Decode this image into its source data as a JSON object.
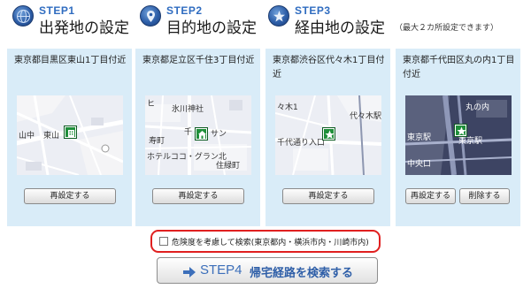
{
  "steps": [
    {
      "number": "STEP1",
      "title": "出発地の設定"
    },
    {
      "number": "STEP2",
      "title": "目的地の設定"
    },
    {
      "number": "STEP3",
      "title": "経由地の設定"
    }
  ],
  "step3_note": "（最大２カ所設定できます）",
  "panels": [
    {
      "address": "東京都目黒区東山1丁目付近",
      "map_labels": [
        "山中",
        "東山"
      ],
      "pin_icon": "building-pin-icon",
      "buttons": [
        "再設定する"
      ]
    },
    {
      "address": "東京都足立区千住3丁目付近",
      "map_labels": [
        "ヒ",
        "氷川神社",
        "寿町",
        "千",
        "サン",
        "ホテルココ・グラン北",
        "住緑町"
      ],
      "pin_icon": "house-pin-icon",
      "buttons": [
        "再設定する"
      ]
    },
    {
      "address": "東京都渋谷区代々木1丁目付近",
      "map_labels": [
        "々木1",
        "代々木駅",
        "千代通り入口"
      ],
      "pin_icon": "waypoint-star-pin-icon",
      "buttons": [
        "再設定する"
      ]
    },
    {
      "address": "東京都千代田区丸の内1丁目付近",
      "map_labels": [
        "丸の内",
        "東京駅",
        "東京駅",
        "中央口"
      ],
      "pin_icon": "waypoint-star-pin-icon",
      "buttons": [
        "再設定する",
        "削除する"
      ]
    }
  ],
  "danger_checkbox": {
    "checked": false,
    "label": "危険度を考慮して検索(東京都内・横浜市内・川崎市内)"
  },
  "search_button": {
    "step": "STEP4",
    "label": "帰宅経路を検索する"
  },
  "colors": {
    "panel_bg": "#d9ecf8",
    "step_blue": "#2f6cc0",
    "pin_green": "#1f8f3a",
    "highlight_red": "#e02020"
  }
}
